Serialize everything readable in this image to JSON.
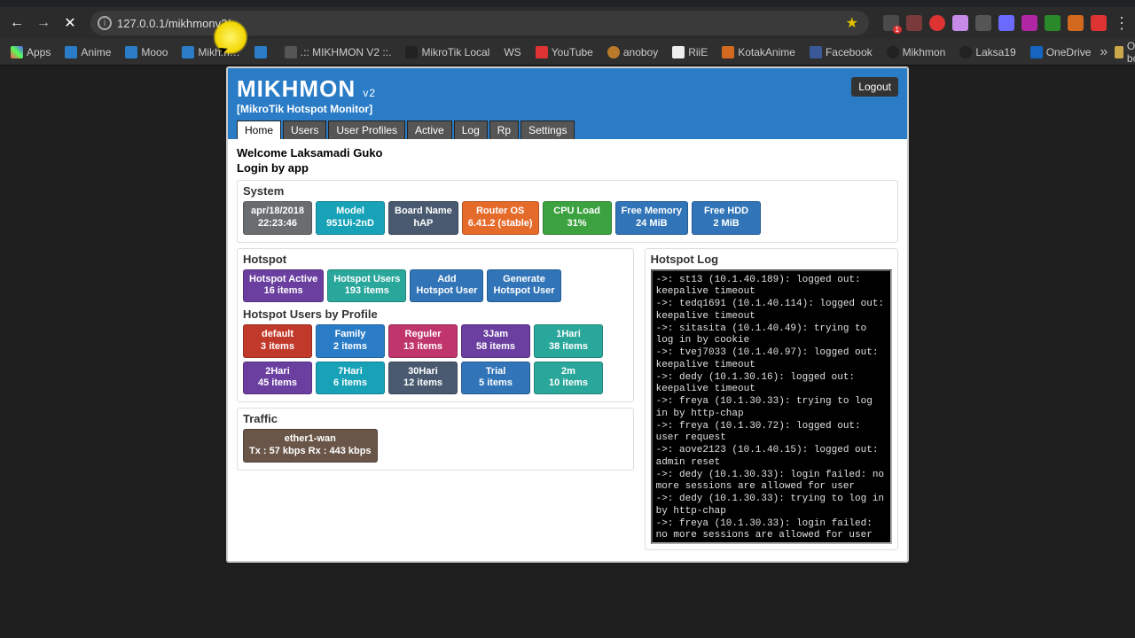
{
  "browser": {
    "address": "127.0.0.1/mikhmonv2/",
    "bookmarks": [
      "Apps",
      "Anime",
      "Mooo",
      "Mikhm…",
      "",
      ".:: MIKHMON V2 ::.",
      "MikroTik Local",
      "WS",
      "YouTube",
      "anoboy",
      "RiiE",
      "KotakAnime",
      "Facebook",
      "Mikhmon",
      "Laksa19",
      "OneDrive"
    ],
    "other_bookmarks_label": "Other bookmarks"
  },
  "header": {
    "brand": "MIKHMON",
    "brand_suffix": "v2",
    "subtitle": "[MikroTik Hotspot Monitor]",
    "logout": "Logout"
  },
  "nav": {
    "tabs": [
      "Home",
      "Users",
      "User Profiles",
      "Active",
      "Log",
      "Rp",
      "Settings"
    ],
    "active": 0
  },
  "welcome_line": "Welcome Laksamadi Guko",
  "login_line": "Login by app",
  "system": {
    "title": "System",
    "tiles": [
      {
        "t": "apr/18/2018",
        "b": "22:23:46",
        "cls": "c-grey"
      },
      {
        "t": "Model",
        "b": "951Ui-2nD",
        "cls": "c-teal"
      },
      {
        "t": "Board Name",
        "b": "hAP",
        "cls": "c-darkblue"
      },
      {
        "t": "Router OS",
        "b": "6.41.2 (stable)",
        "cls": "c-orange"
      },
      {
        "t": "CPU Load",
        "b": "31%",
        "cls": "c-green"
      },
      {
        "t": "Free Memory",
        "b": "24 MiB",
        "cls": "c-dblue"
      },
      {
        "t": "Free HDD",
        "b": "2 MiB",
        "cls": "c-dblue"
      }
    ]
  },
  "hotspot": {
    "title": "Hotspot",
    "tiles": [
      {
        "t": "Hotspot Active",
        "b": "16 items",
        "cls": "c-purple"
      },
      {
        "t": "Hotspot Users",
        "b": "193 items",
        "cls": "c-teal2"
      },
      {
        "t": "Add",
        "b": "Hotspot User",
        "cls": "c-dblue"
      },
      {
        "t": "Generate",
        "b": "Hotspot User",
        "cls": "c-dblue"
      }
    ]
  },
  "profiles": {
    "title": "Hotspot Users by Profile",
    "tiles": [
      {
        "t": "default",
        "b": "3 items",
        "cls": "c-red"
      },
      {
        "t": "Family",
        "b": "2 items",
        "cls": "c-blue"
      },
      {
        "t": "Reguler",
        "b": "13 items",
        "cls": "c-crimson"
      },
      {
        "t": "3Jam",
        "b": "58 items",
        "cls": "c-purple"
      },
      {
        "t": "1Hari",
        "b": "38 items",
        "cls": "c-teal2"
      },
      {
        "t": "2Hari",
        "b": "45 items",
        "cls": "c-purple"
      },
      {
        "t": "7Hari",
        "b": "6 items",
        "cls": "c-teal"
      },
      {
        "t": "30Hari",
        "b": "12 items",
        "cls": "c-darkblue"
      },
      {
        "t": "Trial",
        "b": "5 items",
        "cls": "c-dblue"
      },
      {
        "t": "2m",
        "b": "10 items",
        "cls": "c-teal2"
      }
    ]
  },
  "traffic": {
    "title": "Traffic",
    "tiles": [
      {
        "t": "ether1-wan",
        "b": "Tx : 57 kbps Rx : 443 kbps",
        "cls": "c-brown"
      }
    ]
  },
  "hotspot_log": {
    "title": "Hotspot Log",
    "text": "->: st13 (10.1.40.189): logged out: keepalive timeout\n->: tedq1691 (10.1.40.114): logged out: keepalive timeout\n->: sitasita (10.1.40.49): trying to log in by cookie\n->: tvej7033 (10.1.40.97): logged out: keepalive timeout\n->: dedy (10.1.30.16): logged out: keepalive timeout\n->: freya (10.1.30.33): trying to log in by http-chap\n->: freya (10.1.30.72): logged out: user request\n->: aove2123 (10.1.40.15): logged out: admin reset\n->: dedy (10.1.30.33): login failed: no more sessions are allowed for user\n->: dedy (10.1.30.33): trying to log in by http-chap\n->: freya (10.1.30.33): login failed: no more sessions are allowed for user\n->: freya (10.1.30.33): trying to log in by http-chap\n->: freya (10.1.30.33): login failed:"
  }
}
